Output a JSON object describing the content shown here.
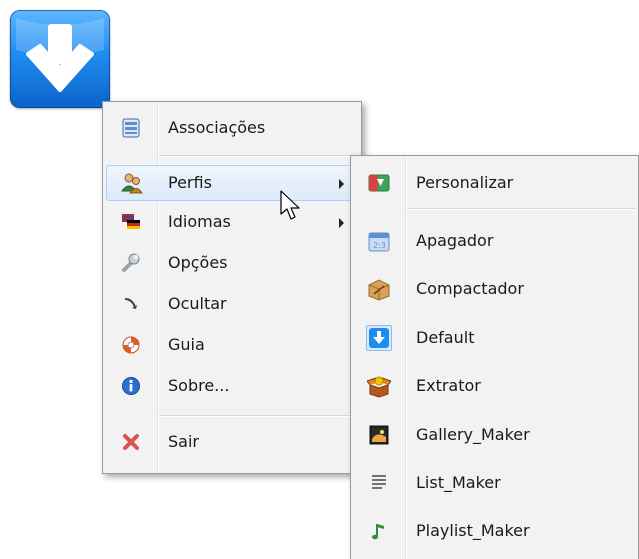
{
  "app_icon": {
    "name": "download-arrow-icon"
  },
  "main_menu": {
    "items": [
      {
        "label": "Associações",
        "icon": "associations-icon"
      },
      {
        "label": "Perfis",
        "icon": "profiles-icon",
        "submenu": true
      },
      {
        "label": "Idiomas",
        "icon": "languages-flag-icon",
        "submenu": true
      },
      {
        "label": "Opções",
        "icon": "wrench-icon"
      },
      {
        "label": "Ocultar",
        "icon": "hide-arrow-icon"
      },
      {
        "label": "Guia",
        "icon": "lifebuoy-icon"
      },
      {
        "label": "Sobre...",
        "icon": "info-icon"
      },
      {
        "label": "Sair",
        "icon": "close-x-icon"
      }
    ]
  },
  "profiles_submenu": {
    "items": [
      {
        "label": "Personalizar",
        "icon": "customize-icon"
      },
      {
        "label": "Apagador",
        "icon": "eraser-calendar-icon"
      },
      {
        "label": "Compactador",
        "icon": "box-icon"
      },
      {
        "label": "Default",
        "icon": "download-arrow-icon"
      },
      {
        "label": "Extrator",
        "icon": "open-box-icon"
      },
      {
        "label": "Gallery_Maker",
        "icon": "picture-icon"
      },
      {
        "label": "List_Maker",
        "icon": "list-icon"
      },
      {
        "label": "Playlist_Maker",
        "icon": "music-note-icon"
      }
    ]
  }
}
